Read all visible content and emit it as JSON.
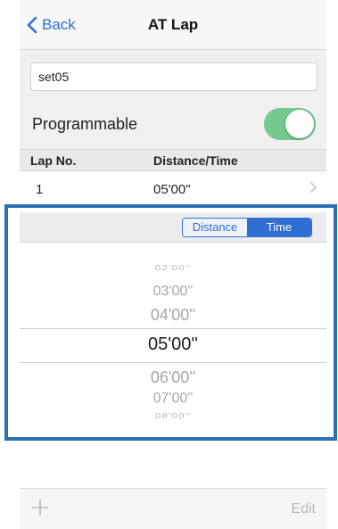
{
  "nav": {
    "back_label": "Back",
    "title": "AT Lap"
  },
  "form": {
    "name_value": "set05",
    "programmable_label": "Programmable",
    "programmable_on": true
  },
  "table": {
    "headers": [
      "Lap No.",
      "Distance/Time"
    ],
    "rows": [
      {
        "lap": "1",
        "value": "05'00\""
      }
    ]
  },
  "segment": {
    "options": [
      "Distance",
      "Time"
    ],
    "selected": "Time"
  },
  "picker": {
    "items": [
      "02'00''",
      "03'00''",
      "04'00''",
      "05'00''",
      "06'00''",
      "07'00''",
      "08'00''"
    ],
    "selected": "05'00''"
  },
  "toolbar": {
    "add_icon": "plus-icon",
    "edit_label": "Edit"
  },
  "colors": {
    "accent": "#2f6fd3",
    "toggle_on": "#74c98f",
    "frame": "#2b70b6"
  }
}
